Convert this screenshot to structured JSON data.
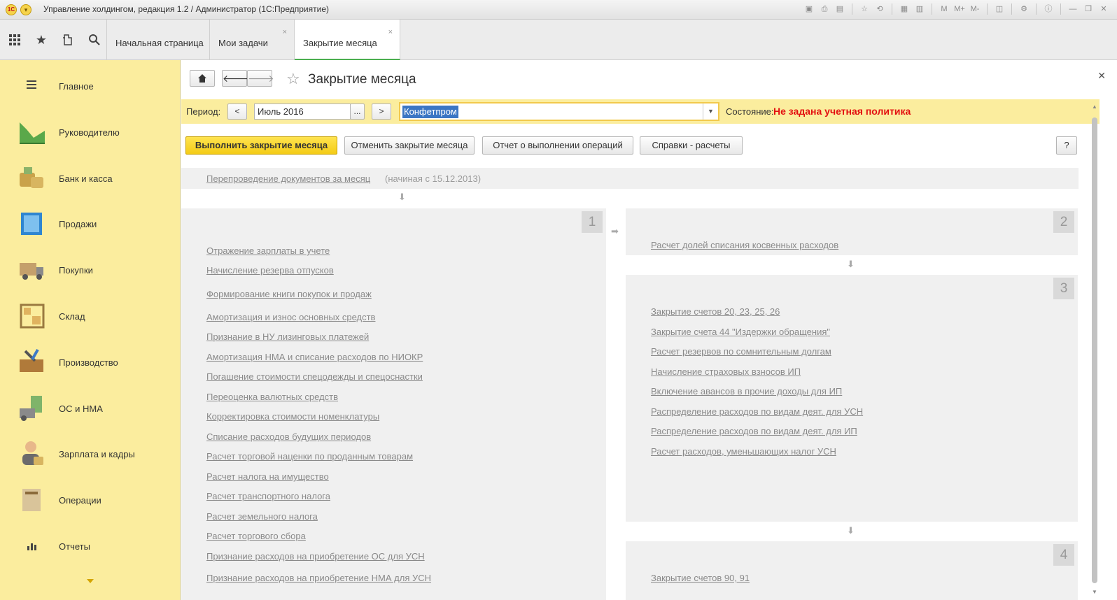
{
  "window": {
    "title": "Управление холдингом, редакция 1.2 / Администратор  (1С:Предприятие)",
    "tools": [
      "save-icon",
      "print-icon",
      "preview-icon",
      "favorite-add-icon",
      "history-icon",
      "calc-icon",
      "calendar-icon",
      "m-icon",
      "m-plus-icon",
      "m-minus-icon",
      "panel-icon",
      "settings-icon",
      "info-icon",
      "minimize-icon",
      "restore-icon",
      "close-icon"
    ],
    "tool_glyphs": [
      "▣",
      "⎙",
      "▤",
      "☆",
      "⟲",
      "▦",
      "▥",
      "M",
      "M+",
      "M-",
      "◫",
      "⚙",
      "ⓘ",
      "—",
      "❐",
      "✕"
    ]
  },
  "tabs": {
    "home": "Начальная страница",
    "tasks": "Мои задачи",
    "active": "Закрытие месяца",
    "close_glyph": "×"
  },
  "sidebar": {
    "items": [
      {
        "label": "Главное",
        "icon": "menu-icon"
      },
      {
        "label": "Руководителю",
        "icon": "chart-icon"
      },
      {
        "label": "Банк и касса",
        "icon": "coins-icon"
      },
      {
        "label": "Продажи",
        "icon": "building-icon"
      },
      {
        "label": "Покупки",
        "icon": "truck-icon"
      },
      {
        "label": "Склад",
        "icon": "warehouse-icon"
      },
      {
        "label": "Производство",
        "icon": "tools-icon"
      },
      {
        "label": "ОС и НМА",
        "icon": "equipment-icon"
      },
      {
        "label": "Зарплата и кадры",
        "icon": "person-icon"
      },
      {
        "label": "Операции",
        "icon": "folder-icon"
      },
      {
        "label": "Отчеты",
        "icon": "bar-chart-icon"
      }
    ]
  },
  "form": {
    "title": "Закрытие месяца",
    "period_label": "Период:",
    "period_value": "Июль 2016",
    "prev_btn": "<",
    "next_btn": ">",
    "select_btn": "...",
    "organization": "Конфетпром",
    "state_label": "Состояние:",
    "state_value": "Не задана учетная политика",
    "buttons": {
      "execute": "Выполнить закрытие месяца",
      "cancel": "Отменить закрытие месяца",
      "report": "Отчет о выполнении операций",
      "references": "Справки - расчеты",
      "help": "?"
    },
    "repost_link": "Перепроведение документов за месяц",
    "repost_note": "(начиная с 15.12.2013)",
    "colors": {
      "accent": "#fbed9e",
      "primary_button": "#f4cc16",
      "state": "#e31010"
    }
  },
  "groups": [
    {
      "number": "1",
      "operations": [
        "Отражение зарплаты в учете",
        "Начисление резерва отпусков",
        "Формирование книги покупок и продаж",
        "Амортизация и износ основных средств",
        "Признание в НУ лизинговых платежей",
        "Амортизация НМА и списание расходов по НИОКР",
        "Погашение стоимости спецодежды и спецоснастки",
        "Переоценка валютных средств",
        "Корректировка стоимости номенклатуры",
        "Списание расходов будущих периодов",
        "Расчет торговой наценки по проданным товарам",
        "Расчет налога на имущество",
        "Расчет транспортного налога",
        "Расчет земельного налога",
        "Расчет торгового сбора",
        "Признание расходов на приобретение ОС для УСН",
        "Признание расходов на приобретение НМА для УСН"
      ]
    },
    {
      "number": "2",
      "operations": [
        "Расчет долей списания косвенных расходов"
      ]
    },
    {
      "number": "3",
      "operations": [
        "Закрытие счетов 20, 23, 25, 26",
        "Закрытие счета 44 \"Издержки обращения\"",
        "Расчет резервов по сомнительным долгам",
        "Начисление страховых взносов ИП",
        "Включение авансов в прочие доходы для ИП",
        "Распределение расходов по видам деят. для УСН",
        "Распределение расходов по видам деят. для ИП",
        "Расчет расходов, уменьшающих налог УСН"
      ]
    },
    {
      "number": "4",
      "operations": [
        "Закрытие счетов 90, 91"
      ]
    }
  ]
}
